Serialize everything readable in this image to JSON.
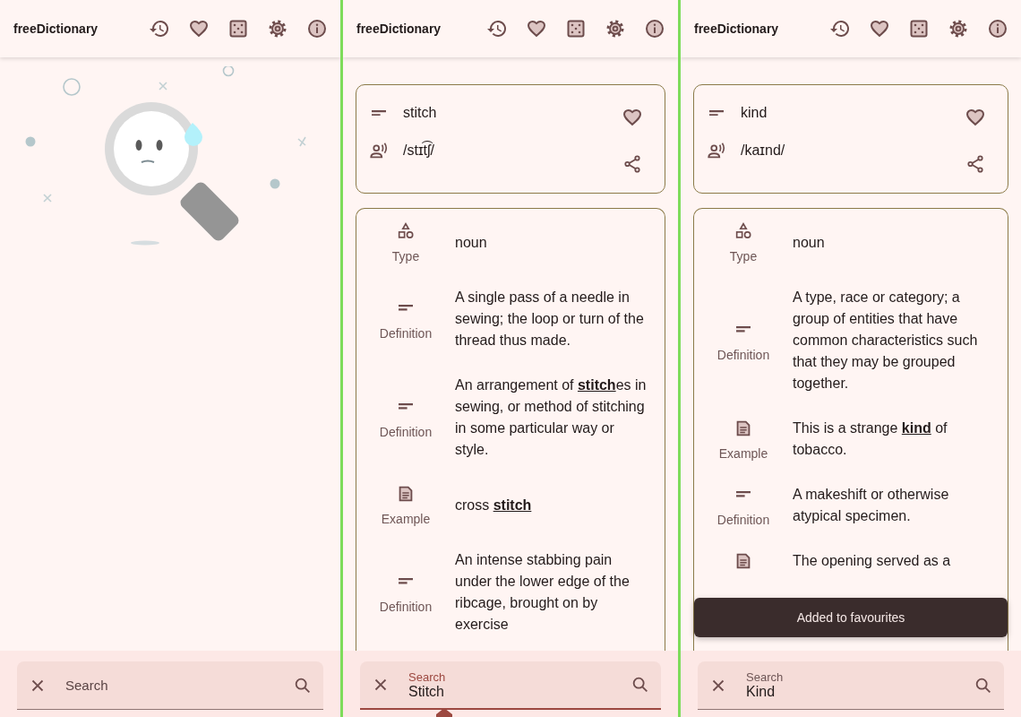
{
  "panels": [
    {
      "app_bar": {
        "title": "freeDictionary"
      },
      "kind": "empty",
      "search": {
        "placeholder": "Search",
        "focused": false
      }
    },
    {
      "app_bar": {
        "title": "freeDictionary"
      },
      "kind": "entry",
      "entry": {
        "word": "stitch",
        "phonetic": "/stɪt͡ʃ/",
        "favourite": true,
        "meanings": [
          {
            "kind": "type",
            "label": "Type",
            "text": "noun"
          },
          {
            "kind": "definition",
            "label": "Definition",
            "text": "A single pass of a needle in sewing; the loop or turn of the thread thus made."
          },
          {
            "kind": "definition",
            "label": "Definition",
            "text": "An arrangement of **stitch**es in sewing, or method of stitching in some particular way or style."
          },
          {
            "kind": "example",
            "label": "Example",
            "text": "cross **stitch**"
          },
          {
            "kind": "definition",
            "label": "Definition",
            "text": "An intense stabbing pain under the lower edge of the ribcage, brought on by exercise"
          }
        ]
      },
      "search": {
        "label": "Search",
        "value": "Stitch",
        "focused": true
      }
    },
    {
      "app_bar": {
        "title": "freeDictionary"
      },
      "kind": "entry",
      "entry": {
        "word": "kind",
        "phonetic": "/kaɪnd/",
        "favourite": true,
        "meanings": [
          {
            "kind": "type",
            "label": "Type",
            "text": "noun"
          },
          {
            "kind": "definition",
            "label": "Definition",
            "text": "A type, race or category; a group of entities that have common characteristics such that they may be grouped together."
          },
          {
            "kind": "example",
            "label": "Example",
            "text": "This is a strange **kind** of tobacco."
          },
          {
            "kind": "definition",
            "label": "Definition",
            "text": "A makeshift or otherwise atypical specimen."
          },
          {
            "kind": "example",
            "text": "The opening served as a"
          }
        ]
      },
      "search": {
        "label": "Search",
        "value": "Kind",
        "focused": false
      },
      "snackbar": "Added to favourites"
    }
  ]
}
